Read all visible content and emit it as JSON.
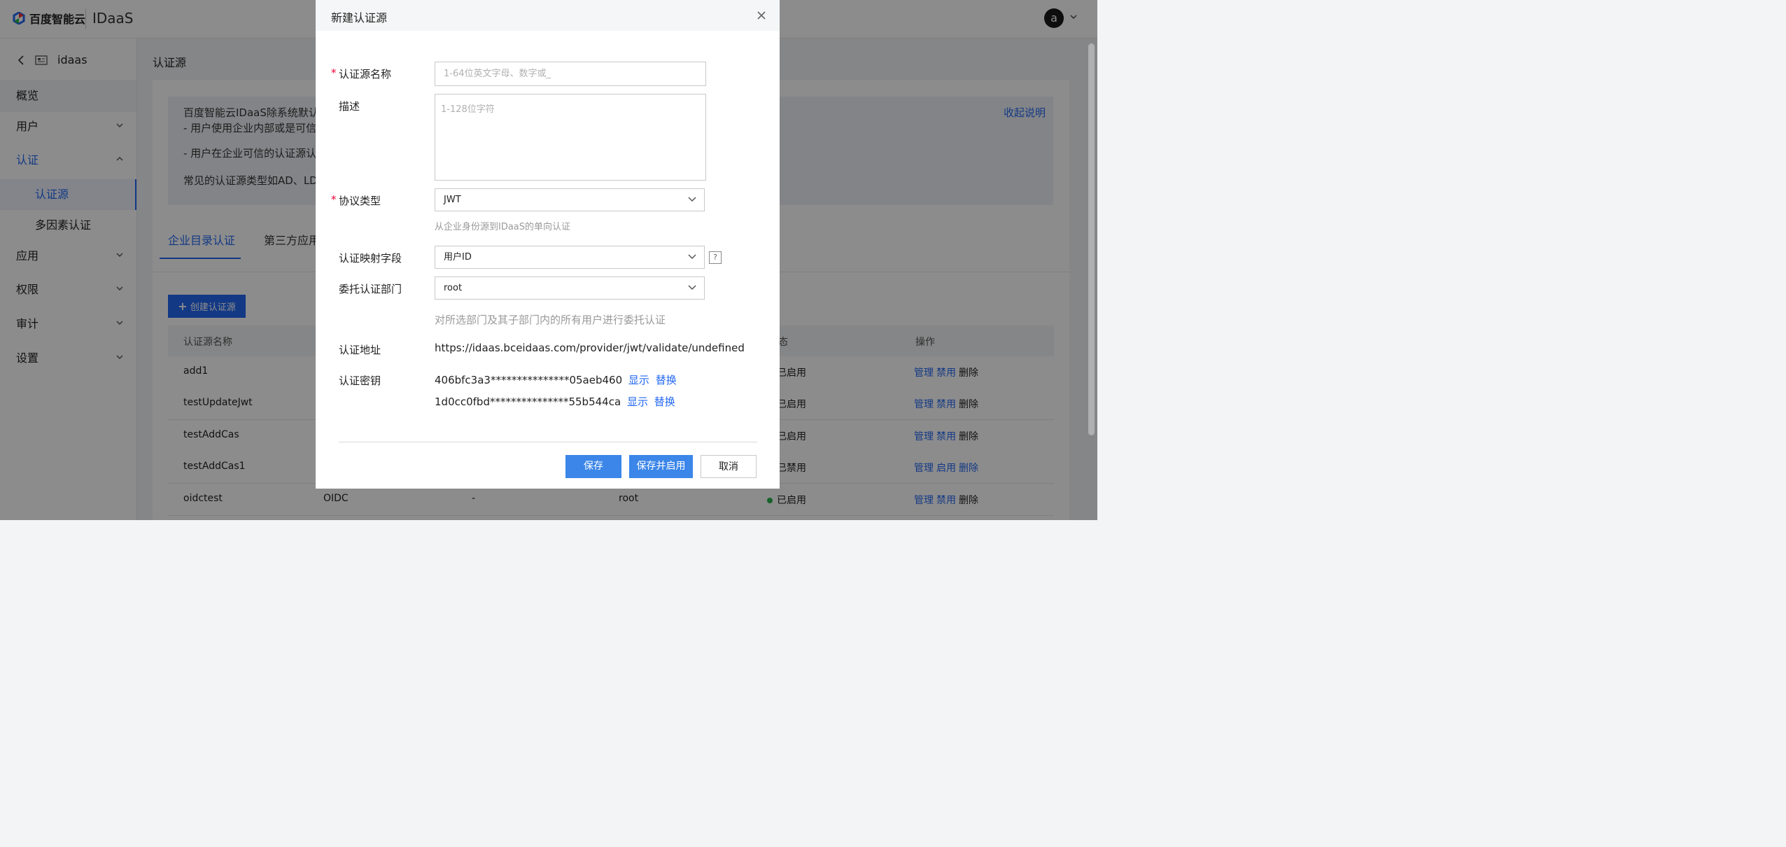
{
  "topbar": {
    "brand": "百度智能云",
    "product": "IDaaS",
    "avatar_letter": "a"
  },
  "sidebar": {
    "back_label": "idaas",
    "items": [
      {
        "label": "概览"
      },
      {
        "label": "用户"
      },
      {
        "label": "认证"
      },
      {
        "label": "认证源"
      },
      {
        "label": "多因素认证"
      },
      {
        "label": "应用"
      },
      {
        "label": "权限"
      },
      {
        "label": "审计"
      },
      {
        "label": "设置"
      }
    ]
  },
  "main": {
    "title": "认证源",
    "notice": {
      "line1": "百度智能云IDaaS除系统默认",
      "line2": "- 用户使用企业内部或是可信",
      "line3": "- 用户在企业可信的认证源认",
      "line4": "常见的认证源类型如AD、LD",
      "collapse": "收起说明"
    },
    "tabs": [
      {
        "label": "企业目录认证"
      },
      {
        "label": "第三方应用"
      }
    ],
    "create_button": "创建认证源",
    "table": {
      "headers": {
        "name": "认证源名称",
        "status": "态",
        "ops": "操作"
      },
      "rows": [
        {
          "name": "add1",
          "type": "",
          "desc": "",
          "dept": "",
          "status": "已启用",
          "status_color": "#2bb24c",
          "op1": "管理",
          "op2": "禁用",
          "op3": "删除"
        },
        {
          "name": "testUpdateJwt",
          "type": "",
          "desc": "",
          "dept": "",
          "status": "已启用",
          "status_color": "#2bb24c",
          "op1": "管理",
          "op2": "禁用",
          "op3": "删除"
        },
        {
          "name": "testAddCas",
          "type": "",
          "desc": "",
          "dept": "",
          "status": "已启用",
          "status_color": "#2bb24c",
          "op1": "管理",
          "op2": "禁用",
          "op3": "删除"
        },
        {
          "name": "testAddCas1",
          "type": "",
          "desc": "",
          "dept": "",
          "status": "已禁用",
          "status_color": "#999999",
          "op1": "管理",
          "op2": "启用",
          "op3": "删除"
        },
        {
          "name": "oidctest",
          "type": "OIDC",
          "desc": "-",
          "dept": "root",
          "status": "已启用",
          "status_color": "#2bb24c",
          "op1": "管理",
          "op2": "禁用",
          "op3": "删除"
        }
      ]
    }
  },
  "modal": {
    "title": "新建认证源",
    "fields": {
      "name_label": "认证源名称",
      "name_placeholder": "1-64位英文字母、数字或_",
      "desc_label": "描述",
      "desc_placeholder": "1-128位字符",
      "protocol_label": "协议类型",
      "protocol_value": "JWT",
      "protocol_hint": "从企业身份源到IDaaS的单向认证",
      "mapping_label": "认证映射字段",
      "mapping_value": "用户ID",
      "help_icon": "?",
      "dept_label": "委托认证部门",
      "dept_value": "root",
      "dept_hint": "对所选部门及其子部门内的所有用户进行委托认证",
      "url_label": "认证地址",
      "url_value": "https://idaas.bceidaas.com/provider/jwt/validate/undefined",
      "secret_label": "认证密钥",
      "secret1": "406bfc3a3***************05aeb460",
      "secret2": "1d0cc0fbd***************55b544ca",
      "show_label": "显示",
      "replace_label": "替换"
    },
    "buttons": {
      "save": "保存",
      "save_enable": "保存并启用",
      "cancel": "取消"
    }
  },
  "colors": {
    "accent": "#2468f2",
    "required": "#ee0033",
    "enabled": "#2bb24c"
  }
}
